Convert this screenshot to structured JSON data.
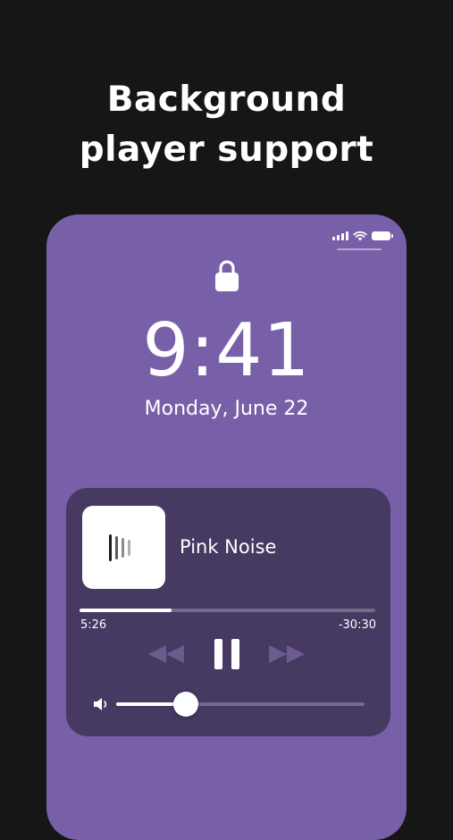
{
  "promo": {
    "line1": "Background",
    "line2": "player support"
  },
  "lock_screen": {
    "time": "9:41",
    "date": "Monday, June 22"
  },
  "now_playing": {
    "title": "Pink Noise",
    "elapsed": "5:26",
    "remaining": "-30:30",
    "progress_fraction": 0.31,
    "volume_fraction": 0.28,
    "state": "playing"
  },
  "colors": {
    "background": "#161616",
    "phone_purple": "#7860a9",
    "card_purple": "#463962",
    "inactive_control": "#6b5b8e"
  },
  "icons": {
    "status": [
      "signal-icon",
      "wifi-icon",
      "battery-icon"
    ],
    "lock": "lock-icon",
    "controls": [
      "rewind-icon",
      "pause-icon",
      "fast-forward-icon"
    ],
    "volume": "speaker-icon"
  }
}
